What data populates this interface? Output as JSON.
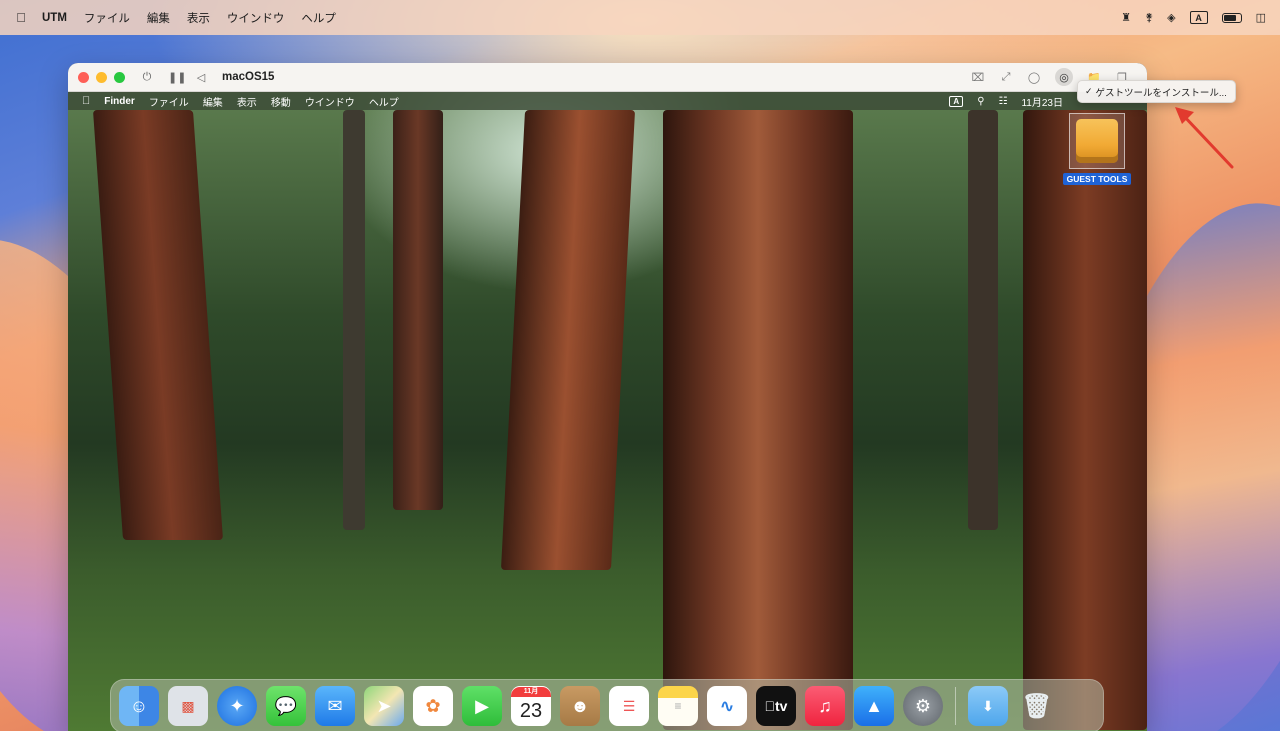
{
  "host_menubar": {
    "app_name": "UTM",
    "items": [
      "ファイル",
      "編集",
      "表示",
      "ウインドウ",
      "ヘルプ"
    ],
    "input_badge": "A"
  },
  "window": {
    "title": "macOS15",
    "popup_item": "ゲストツールをインストール..."
  },
  "guest_menubar": {
    "app_name": "Finder",
    "items": [
      "ファイル",
      "編集",
      "表示",
      "移動",
      "ウインドウ",
      "ヘルプ"
    ],
    "input_badge": "A",
    "clock": "11月23日"
  },
  "desktop": {
    "volume_label": "GUEST TOOLS"
  },
  "dock": {
    "calendar_month": "11月",
    "calendar_day": "23",
    "tv_label": "tv",
    "apps": [
      "finder-icon",
      "launchpad-icon",
      "safari-icon",
      "messages-icon",
      "mail-icon",
      "maps-icon",
      "photos-icon",
      "facetime-icon",
      "calendar-icon",
      "contacts-icon",
      "reminders-icon",
      "notes-icon",
      "freeform-icon",
      "tv-icon",
      "music-icon",
      "app-store-icon",
      "system-settings-icon",
      "downloads-folder-icon",
      "trash-icon"
    ]
  },
  "colors": {
    "accent_blue": "#1f63d6",
    "arrow_red": "#e23a2e",
    "traffic_red": "#fe5f57",
    "traffic_yellow": "#febc2e",
    "traffic_green": "#28c840"
  }
}
